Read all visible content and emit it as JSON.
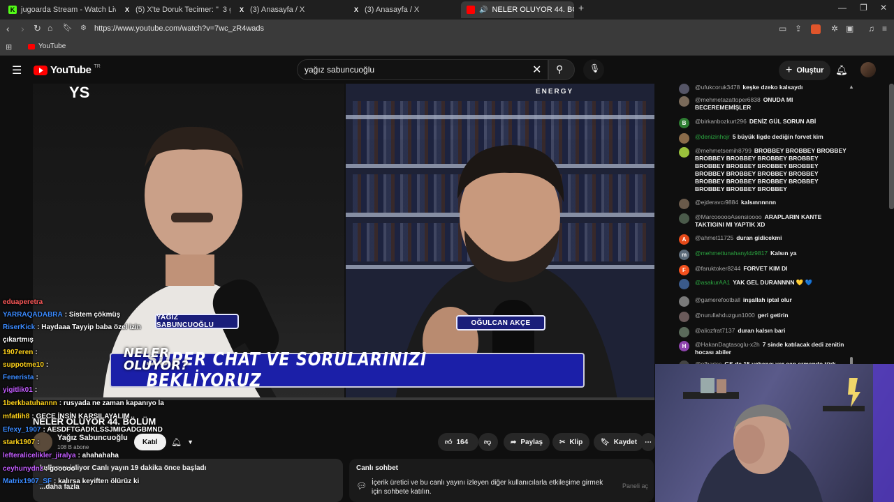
{
  "browser": {
    "tabs": [
      {
        "title": "jugoarda Stream - Watch Live on Kick",
        "icon": "K",
        "color": "#53fc18"
      },
      {
        "title": "(5) X'te Doruk Tecimer: \"",
        "extra": "3 gün ön",
        "icon": "X",
        "color": "#ffffff"
      },
      {
        "title": "(3) Anasayfa / X",
        "icon": "X",
        "color": "#ffffff"
      },
      {
        "title": "(3) Anasayfa / X",
        "icon": "X",
        "color": "#ffffff"
      },
      {
        "title": "NELER OLUYOR 44. BÖLÜM -",
        "icon": "yt",
        "color": "#ff0000"
      }
    ],
    "url": "https://www.youtube.com/watch?v=7wc_zR4wads",
    "bookmark": "YouTube"
  },
  "yt": {
    "logo": "YouTube",
    "region": "TR",
    "search_value": "yağız sabuncuoğlu",
    "create_label": "Oluştur"
  },
  "video": {
    "name_left": "YAĞIZ SABUNCUOĞLU",
    "name_right": "OĞULCAN AKÇE",
    "banner": "SUPER CHAT VE SORULARINIZI BEKLİYORUZ",
    "banner_logo_1": "NELER",
    "banner_logo_2": "OLUYOR?",
    "corner_mark": "YS",
    "sponsor": "ENERGY"
  },
  "meta": {
    "title": "NELER OLUYOR 44. BÖLÜM",
    "channel": "Yağız Sabuncuoğlu",
    "subs": "108 B abone",
    "join": "Katıl",
    "likes": "164",
    "share": "Paylaş",
    "clip": "Klip",
    "save": "Kaydet",
    "stats": "kullanıcı izliyor  Canlı yayın 19 dakika önce başladı",
    "more": "...daha fazla"
  },
  "live_chat": {
    "title": "Canlı sohbet",
    "info": "İçerik üretici ve bu canlı yayını izleyen diğer kullanıcılarla etkileşime girmek için sohbete katılın.",
    "panel": "Paneli aç"
  },
  "kick_chat": [
    {
      "user": "eduaperetra",
      "msg": "",
      "color": "#ff5a5a"
    },
    {
      "user": "YARRAQADABRA",
      "msg": ": Sistem çökmüş",
      "color": "#3b8bff"
    },
    {
      "user": "RiserKick",
      "msg": ": Haydaaa Tayyip baba özel izin",
      "color": "#3b8bff"
    },
    {
      "user": "çıkartmış",
      "msg": "",
      "color": "#ffffff"
    },
    {
      "user": "1907eren",
      "msg": ":",
      "color": "#ffd21a"
    },
    {
      "user": "suppotme10",
      "msg": ":",
      "color": "#ffd21a"
    },
    {
      "user": "Fenerista",
      "msg": ":",
      "color": "#3b8bff"
    },
    {
      "user": "yigitlik01",
      "msg": ":",
      "color": "#c35cff"
    },
    {
      "user": "1berkbatuhannn",
      "msg": ": rusyada ne zaman kapanıyo la",
      "color": "#ffd21a"
    },
    {
      "user": "mfatlih8",
      "msg": ": GECE İNSİN KARŞILAYALIM",
      "color": "#ffd21a"
    },
    {
      "user": "Efexy_1907",
      "msg": ": AESDFTGADKLSSJMIGADGBMND",
      "color": "#3b8bff"
    },
    {
      "user": "stark1907",
      "msg": ":",
      "color": "#ffd21a"
    },
    {
      "user": "lefteralicelikler_jiralya",
      "msg": ": ahahahaha",
      "color": "#c35cff"
    },
    {
      "user": "ceyhunydnz",
      "msg": ": gooooo",
      "color": "#c35cff"
    },
    {
      "user": "Matrix1907_SF",
      "msg": ": kalırsa keyiften ölürüz ki",
      "color": "#3b8bff"
    }
  ],
  "chat": [
    {
      "user": "@ufukcoruk3478",
      "text": "keşke dzeko kalsaydı",
      "av": "",
      "avcolor": "#556"
    },
    {
      "user": "@mehmetazattoper6838",
      "text": "ONUDA MI BECEREMEMİŞLER",
      "av": "",
      "avcolor": "#7a6a5a"
    },
    {
      "user": "@birkanbozkurt296",
      "text": "DENİZ GÜL SORUN ABİ",
      "av": "B",
      "avcolor": "#2e7d32"
    },
    {
      "user": "@denizinhojr",
      "text": "5 büyük ligde dediğin forvet kim",
      "av": "",
      "avcolor": "#8a6b4a",
      "usercolor": "#2ba640"
    },
    {
      "user": "@mehmetsemih8799",
      "text": "BROBBEY BROBBEY BROBBEY BROBBEY BROBBEY BROBBEY BROBBEY BROBBEY BROBBEY BROBBEY BROBBEY BROBBEY BROBBEY BROBBEY BROBBEY BROBBEY BROBBEY BROBBEY BROBBEY BROBBEY BROBBEY BROBBEY",
      "av": "",
      "avcolor": "#9ac23c"
    },
    {
      "user": "@ejderavcı9884",
      "text": "kalsınnnnnn",
      "av": "",
      "avcolor": "#6a5a4a"
    },
    {
      "user": "@MarcoooooAsensioooo",
      "text": "ARAPLARIN KANTE TAKTIGINI MI YAPTIK XD",
      "av": "",
      "avcolor": "#4a5a4a"
    },
    {
      "user": "@ahmet11725",
      "text": "duran gidicekmi",
      "av": "A",
      "avcolor": "#e64a19"
    },
    {
      "user": "@mehmettunahanyldz9817",
      "text": "Kalsın ya",
      "av": "m",
      "avcolor": "#5c6b7a",
      "usercolor": "#2ba640"
    },
    {
      "user": "@faruktoker8244",
      "text": "FORVET KIM DI",
      "av": "F",
      "avcolor": "#f4511e"
    },
    {
      "user": "@asakurAA1",
      "text": "YAK GEL DURANNNN 💛 💙",
      "av": "",
      "avcolor": "#3a5a8a",
      "usercolor": "#2ba640"
    },
    {
      "user": "@gamerefootball",
      "text": "inşallah iptal olur",
      "av": "",
      "avcolor": "#7a7a7a"
    },
    {
      "user": "@nurullahduzgun1000",
      "text": "geri getirin",
      "av": "",
      "avcolor": "#6a5a5a"
    },
    {
      "user": "@aliozfrat7137",
      "text": "duran kalsın bari",
      "av": "",
      "avcolor": "#5a6a5a"
    },
    {
      "user": "@HakanDagtasoglu-x2h",
      "text": "7 sinde katılacak dedi zenitin hocası abiler",
      "av": "H",
      "avcolor": "#8e44ad"
    },
    {
      "user": "@ofbariss",
      "text": "GS de 15 yabancı var can armando türk",
      "av": "",
      "avcolor": "#444"
    }
  ]
}
